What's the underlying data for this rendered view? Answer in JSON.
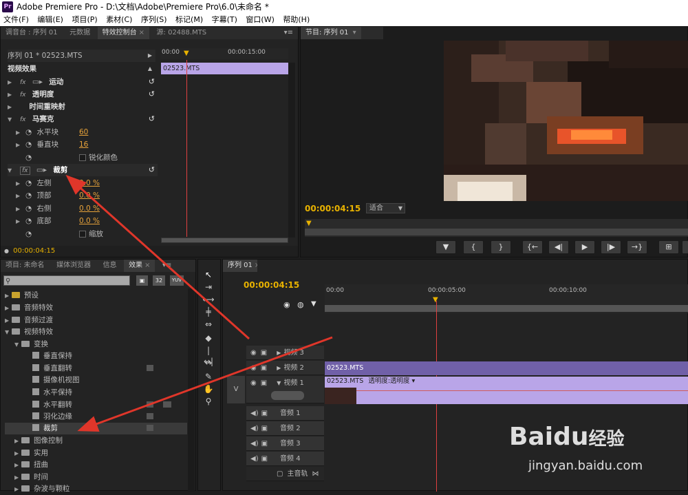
{
  "app": {
    "title": "Adobe Premiere Pro - D:\\文档\\Adobe\\Premiere Pro\\6.0\\未命名 *",
    "logo": "Pr"
  },
  "menu": [
    "文件(F)",
    "编辑(E)",
    "项目(P)",
    "素材(C)",
    "序列(S)",
    "标记(M)",
    "字幕(T)",
    "窗口(W)",
    "帮助(H)"
  ],
  "top_left_tabs": [
    {
      "label": "调音台 : 序列 01"
    },
    {
      "label": "元数据"
    },
    {
      "label": "特效控制台"
    },
    {
      "label": "源: 02488.MTS"
    }
  ],
  "effect_controls": {
    "sequence": "序列 01 * 02523.MTS",
    "ruler": {
      "start": "00:00",
      "mid": "00:00:15:00"
    },
    "section": "视频效果",
    "clip_name": "02523.MTS",
    "effects": [
      {
        "name": "运动",
        "fx": "fx"
      },
      {
        "name": "透明度",
        "fx": "fx"
      },
      {
        "name": "时间重映射",
        "fx": ""
      },
      {
        "name": "马赛克",
        "fx": "fx"
      }
    ],
    "mosaic_params": [
      {
        "name": "水平块",
        "value": "60"
      },
      {
        "name": "垂直块",
        "value": "16"
      },
      {
        "name": "锐化颜色",
        "value": ""
      }
    ],
    "crop": {
      "name": "裁剪",
      "fx": "fx"
    },
    "crop_params": [
      {
        "name": "左侧",
        "value": "0.0 %"
      },
      {
        "name": "顶部",
        "value": "0.0 %"
      },
      {
        "name": "右侧",
        "value": "0.0 %"
      },
      {
        "name": "底部",
        "value": "0.0 %"
      },
      {
        "name": "缩放",
        "value": ""
      }
    ],
    "timecode": "00:00:04:15"
  },
  "program_monitor": {
    "tab": "节目: 序列 01",
    "timecode": "00:00:04:15",
    "fit": "适合",
    "buttons": [
      "marker-icon",
      "mark-in-icon",
      "mark-out-icon",
      "go-to-in-icon",
      "step-back-icon",
      "play-icon",
      "step-forward-icon",
      "go-to-out-icon",
      "lift-icon"
    ]
  },
  "project_panel": {
    "tabs": [
      {
        "label": "项目: 未命名"
      },
      {
        "label": "媒体浏览器"
      },
      {
        "label": "信息"
      },
      {
        "label": "效果"
      }
    ],
    "search_placeholder": "",
    "badges": [
      "32",
      "YUV"
    ],
    "tree": [
      {
        "label": "预设",
        "level": 0,
        "expanded": false
      },
      {
        "label": "音频特效",
        "level": 0,
        "expanded": false
      },
      {
        "label": "音频过渡",
        "level": 0,
        "expanded": false
      },
      {
        "label": "视频特效",
        "level": 0,
        "expanded": true
      },
      {
        "label": "变换",
        "level": 1,
        "expanded": true
      },
      {
        "label": "垂直保持",
        "level": 2
      },
      {
        "label": "垂直翻转",
        "level": 2
      },
      {
        "label": "摄像机视图",
        "level": 2
      },
      {
        "label": "水平保持",
        "level": 2
      },
      {
        "label": "水平翻转",
        "level": 2
      },
      {
        "label": "羽化边缘",
        "level": 2
      },
      {
        "label": "裁剪",
        "level": 2,
        "selected": true
      },
      {
        "label": "图像控制",
        "level": 1,
        "expanded": false
      },
      {
        "label": "实用",
        "level": 1,
        "expanded": false
      },
      {
        "label": "扭曲",
        "level": 1,
        "expanded": false
      },
      {
        "label": "时间",
        "level": 1,
        "expanded": false
      },
      {
        "label": "杂波与颗粒",
        "level": 1,
        "expanded": false
      }
    ]
  },
  "timeline": {
    "tab": "序列 01",
    "timecode": "00:00:04:15",
    "ruler": [
      "00:00",
      "00:00:05:00",
      "00:00:10:00"
    ],
    "target_label": "V",
    "video_tracks": [
      {
        "name": "视频 3",
        "clip": ""
      },
      {
        "name": "视频 2",
        "clip": "02523.MTS"
      },
      {
        "name": "视频 1",
        "clip": "02523.MTS",
        "fx": "透明度:透明度"
      }
    ],
    "audio_tracks": [
      "音频 1",
      "音频 2",
      "音频 3",
      "音频 4"
    ],
    "master": "主音轨"
  },
  "watermark": {
    "brand": "Baidu",
    "brand_cn": "经验",
    "url": "jingyan.baidu.com"
  },
  "colors": {
    "accent": "#e8b200",
    "clip": "#b9a5e8",
    "playhead": "#e04040",
    "arrow": "#e0362a"
  }
}
